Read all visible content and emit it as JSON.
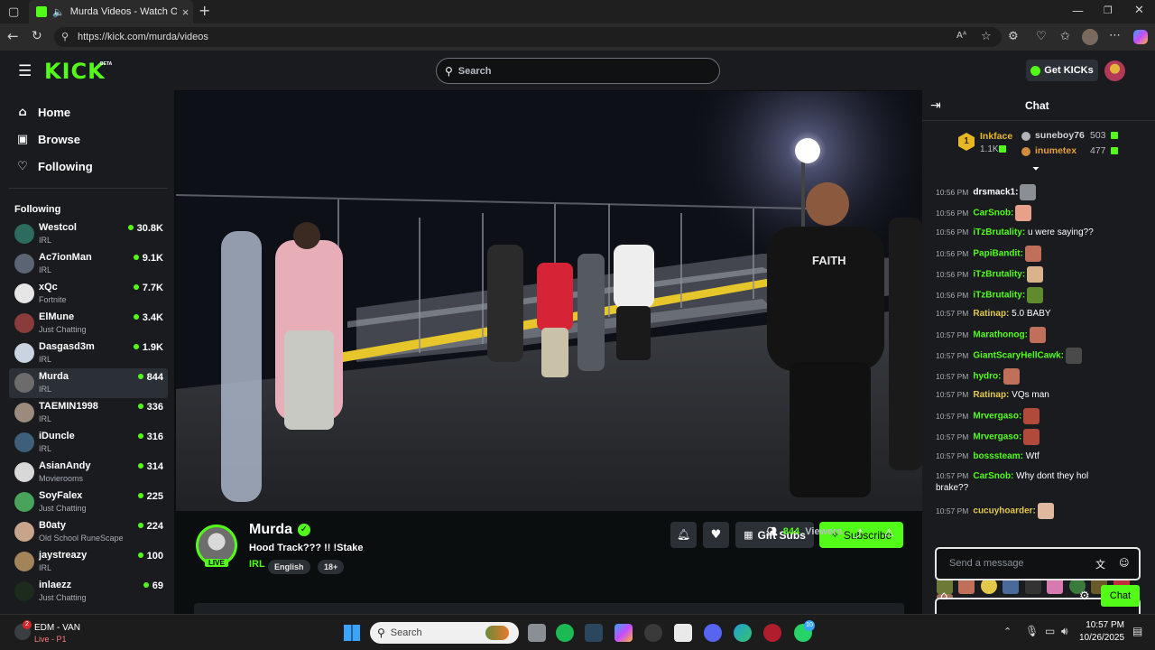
{
  "browser": {
    "tab_title": "Murda Videos - Watch On-D",
    "url": "https://kick.com/murda/videos",
    "close_tab": "×",
    "new_tab": "+"
  },
  "header": {
    "logo": "KICK",
    "logo_beta": "BETA",
    "search_placeholder": "Search",
    "get_kicks": "Get KICKs"
  },
  "sidebar": {
    "nav": [
      {
        "label": "Home",
        "icon": "home-icon"
      },
      {
        "label": "Browse",
        "icon": "browse-icon"
      },
      {
        "label": "Following",
        "icon": "heart-icon"
      }
    ],
    "following_heading": "Following",
    "channels": [
      {
        "name": "Westcol",
        "category": "IRL",
        "viewers": "30.8K",
        "color": "#2d6b5f"
      },
      {
        "name": "Ac7ionMan",
        "category": "IRL",
        "viewers": "9.1K",
        "color": "#5b6472"
      },
      {
        "name": "xQc",
        "category": "Fortnite",
        "viewers": "7.7K",
        "color": "#e6e6e6"
      },
      {
        "name": "ElMune",
        "category": "Just Chatting",
        "viewers": "3.4K",
        "color": "#8a3b3b"
      },
      {
        "name": "Dasgasd3m",
        "category": "IRL",
        "viewers": "1.9K",
        "color": "#c9d4e0"
      },
      {
        "name": "Murda",
        "category": "IRL",
        "viewers": "844",
        "color": "#6c6c6c"
      },
      {
        "name": "TAEMIN1998",
        "category": "IRL",
        "viewers": "336",
        "color": "#9a8b7c"
      },
      {
        "name": "iDuncle",
        "category": "IRL",
        "viewers": "316",
        "color": "#3d5f7a"
      },
      {
        "name": "AsianAndy",
        "category": "Movierooms",
        "viewers": "314",
        "color": "#d8d8d8"
      },
      {
        "name": "SoyFalex",
        "category": "Just Chatting",
        "viewers": "225",
        "color": "#4aa35a"
      },
      {
        "name": "B0aty",
        "category": "Old School RuneScape",
        "viewers": "224",
        "color": "#c7a48a"
      },
      {
        "name": "jaystreazy",
        "category": "IRL",
        "viewers": "100",
        "color": "#a3835a"
      },
      {
        "name": "inlaezz",
        "category": "Just Chatting",
        "viewers": "69",
        "color": "#1c2b1c"
      }
    ]
  },
  "stream": {
    "channel": "Murda",
    "title": "Hood Track??? !! !Stake",
    "category": "IRL",
    "tags": [
      "English",
      "18+"
    ],
    "live_badge": "LIVE",
    "viewers": "844",
    "viewers_label": "Viewers",
    "gift_subs": "Gift Subs",
    "subscribe": "Subscribe"
  },
  "chat": {
    "title": "Chat",
    "leaderboard": [
      {
        "rank": "1",
        "name": "Inkface",
        "amount": "1.1K"
      },
      {
        "name": "suneboy76",
        "amount": "503"
      },
      {
        "name": "inumetex",
        "amount": "477"
      }
    ],
    "messages": [
      {
        "time": "10:56 PM",
        "user": "drsmack1:",
        "text": "",
        "color": "#ffffff",
        "emote": "#8a8f96"
      },
      {
        "time": "10:56 PM",
        "user": "CarSnob:",
        "text": "",
        "color": "#53fc18",
        "emote": "#e8a08a"
      },
      {
        "time": "10:56 PM",
        "user": "iTzBrutality:",
        "text": "u were saying??",
        "color": "#53fc18",
        "emote": ""
      },
      {
        "time": "10:56 PM",
        "user": "PapiBandit:",
        "text": "",
        "color": "#53fc18",
        "emote": "#c0705a"
      },
      {
        "time": "10:56 PM",
        "user": "iTzBrutality:",
        "text": "",
        "color": "#53fc18",
        "emote": "#d9b38c"
      },
      {
        "time": "10:56 PM",
        "user": "iTzBrutality:",
        "text": "",
        "color": "#53fc18",
        "emote": "#5f8a2e"
      },
      {
        "time": "10:57 PM",
        "user": "Ratinap:",
        "text": "5.0 BABY",
        "color": "#e3c84a",
        "emote": ""
      },
      {
        "time": "10:57 PM",
        "user": "Marathonog:",
        "text": "",
        "color": "#53fc18",
        "emote": "#c0705a"
      },
      {
        "time": "10:57 PM",
        "user": "GiantScaryHellCawk:",
        "text": "",
        "color": "#53fc18",
        "emote": "#4a4a4a"
      },
      {
        "time": "10:57 PM",
        "user": "hydro:",
        "text": "",
        "color": "#53fc18",
        "emote": "#c0705a"
      },
      {
        "time": "10:57 PM",
        "user": "Ratinap:",
        "text": "VQs man",
        "color": "#e3c84a",
        "emote": ""
      },
      {
        "time": "10:57 PM",
        "user": "Mrvergaso:",
        "text": "",
        "color": "#53fc18",
        "emote": "#b04a3a"
      },
      {
        "time": "10:57 PM",
        "user": "Mrvergaso:",
        "text": "",
        "color": "#53fc18",
        "emote": "#b04a3a"
      },
      {
        "time": "10:57 PM",
        "user": "bosssteam:",
        "text": "Wtf",
        "color": "#53fc18",
        "emote": ""
      },
      {
        "time": "10:57 PM",
        "user": "CarSnob:",
        "text": "Why dont they hol",
        "color": "#53fc18",
        "emote": ""
      },
      {
        "time": "",
        "user": "",
        "text": "brake??",
        "color": "#ffffff",
        "emote": ""
      },
      {
        "time": "10:57 PM",
        "user": "cucuyhoarder:",
        "text": "",
        "color": "#e3c84a",
        "emote": "#e0b8a0"
      }
    ],
    "input_placeholder": "Send a message",
    "send_button": "Chat"
  },
  "taskbar": {
    "weather_title": "EDM - VAN",
    "weather_sub": "Live - P1",
    "search_placeholder": "Search",
    "notification_count": "2",
    "app_badge": "10",
    "time": "10:57 PM",
    "date": "10/26/2025"
  }
}
